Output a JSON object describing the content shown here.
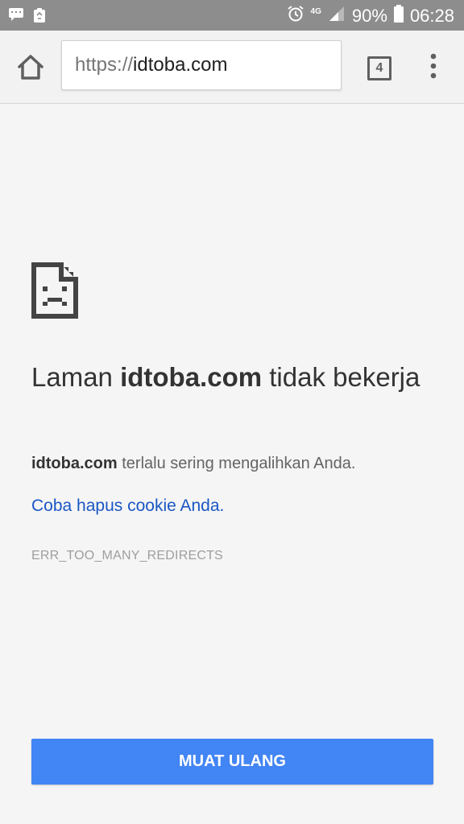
{
  "status_bar": {
    "network": "4G",
    "battery_percent": "90%",
    "time": "06:28"
  },
  "toolbar": {
    "url_scheme": "https://",
    "url_host": "idtoba.com",
    "tab_count": "4"
  },
  "error_page": {
    "heading_prefix": "Laman ",
    "heading_domain": "idtoba.com",
    "heading_suffix": " tidak bekerja",
    "description_domain": "idtoba.com",
    "description_text": " terlalu sering mengalihkan Anda.",
    "suggestion_link": "Coba hapus cookie Anda",
    "suggestion_end": ".",
    "error_code": "ERR_TOO_MANY_REDIRECTS",
    "reload_button": "MUAT ULANG"
  },
  "colors": {
    "status_bar": "#8d8d8d",
    "toolbar": "#f2f2f2",
    "page_background": "#f5f5f5",
    "link": "#1a57c4",
    "button": "#4285f4"
  }
}
